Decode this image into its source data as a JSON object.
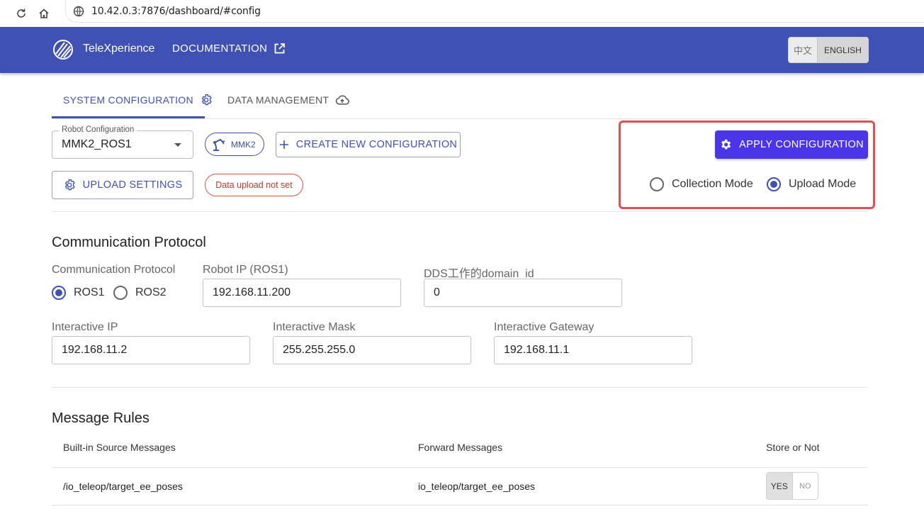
{
  "browser": {
    "url": "10.42.0.3:7876/dashboard/#config"
  },
  "header": {
    "brand": "TeleXperience",
    "docs_link": "DOCUMENTATION",
    "lang_zh": "中文",
    "lang_en": "ENGLISH",
    "active_lang": "ENGLISH",
    "bar_color": "#3f51b5"
  },
  "tabs": [
    {
      "label": "SYSTEM CONFIGURATION",
      "icon": "gear-icon",
      "active": true
    },
    {
      "label": "DATA MANAGEMENT",
      "icon": "cloud-upload-icon",
      "active": false
    }
  ],
  "config": {
    "robot_config_label": "Robot Configuration",
    "robot_config_value": "MMK2_ROS1",
    "robot_chip": "MMK2",
    "create_button": "CREATE NEW CONFIGURATION",
    "upload_settings_button": "UPLOAD SETTINGS",
    "upload_status": "Data upload not set",
    "apply_button": "APPLY CONFIGURATION",
    "apply_color": "#4a36e8",
    "modes": [
      {
        "label": "Collection Mode",
        "selected": false
      },
      {
        "label": "Upload Mode",
        "selected": true
      }
    ]
  },
  "communication": {
    "section_title": "Communication Protocol",
    "protocol_label": "Communication Protocol",
    "protocol_options": [
      {
        "label": "ROS1",
        "selected": true
      },
      {
        "label": "ROS2",
        "selected": false
      }
    ],
    "robot_ip_label": "Robot IP (ROS1)",
    "robot_ip_value": "192.168.11.200",
    "dds_label": "DDS工作的domain_id",
    "dds_value": "0",
    "interactive_ip_label": "Interactive IP",
    "interactive_ip_value": "192.168.11.2",
    "interactive_mask_label": "Interactive Mask",
    "interactive_mask_value": "255.255.255.0",
    "interactive_gateway_label": "Interactive Gateway",
    "interactive_gateway_value": "192.168.11.1"
  },
  "messages": {
    "section_title": "Message Rules",
    "columns": [
      "Built-in Source Messages",
      "Forward Messages",
      "Store or Not"
    ],
    "rows": [
      {
        "source": "/io_teleop/target_ee_poses",
        "forward": "io_teleop/target_ee_poses",
        "yes": "YES",
        "no": "NO",
        "store": "YES"
      }
    ]
  }
}
